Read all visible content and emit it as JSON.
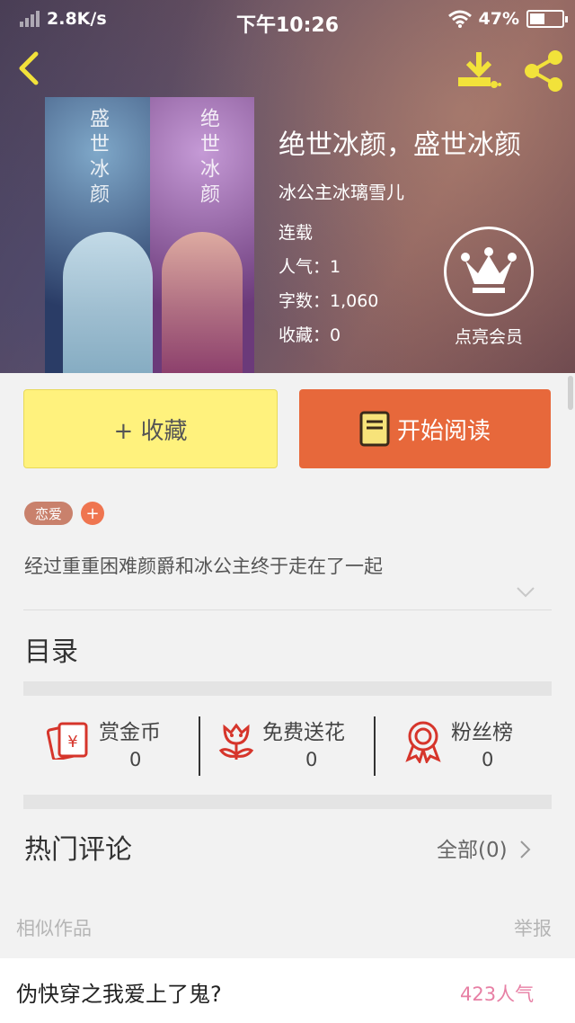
{
  "status_bar": {
    "speed": "2.8K/s",
    "time": "下午10:26",
    "battery": "47%",
    "battery_level": 0.47
  },
  "header": {
    "back_icon": "back-arrow-icon",
    "download_icon": "download-icon",
    "share_icon": "share-icon",
    "icon_color": "#f2e23a"
  },
  "book": {
    "title": "绝世冰颜，盛世冰颜",
    "author": "冰公主冰璃雪儿",
    "status": "连载",
    "popularity": "人气：1",
    "word_count": "字数：1,060",
    "favorites": "收藏：0",
    "cover_text_left": "盛世冰颜",
    "cover_text_right": "绝世冰颜"
  },
  "vip": {
    "label": "点亮会员",
    "icon": "crown-icon"
  },
  "actions": {
    "favorite_label": "+ 收藏",
    "read_label": "开始阅读",
    "favorite_color": "#fff27d",
    "read_color": "#e7683b"
  },
  "tags": {
    "genre": "恋爱",
    "add": "+"
  },
  "description": "经过重重困难颜爵和冰公主终于走在了一起",
  "toc_title": "目录",
  "stats": [
    {
      "name": "赏金币",
      "value": "0",
      "icon": "red-envelope-icon"
    },
    {
      "name": "免费送花",
      "value": "0",
      "icon": "flower-icon"
    },
    {
      "name": "粉丝榜",
      "value": "0",
      "icon": "medal-icon"
    }
  ],
  "comments": {
    "title": "热门评论",
    "all_label": "全部(0)"
  },
  "similar": {
    "title": "相似作品",
    "report": "举报",
    "items": [
      {
        "title": "伪快穿之我爱上了鬼?",
        "popularity": "423人气"
      }
    ]
  }
}
